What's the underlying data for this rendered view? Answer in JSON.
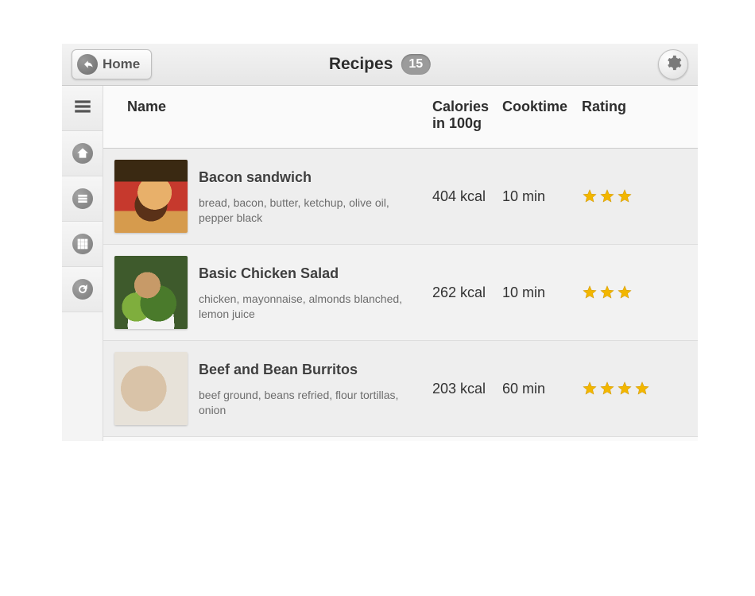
{
  "header": {
    "home_label": "Home",
    "title": "Recipes",
    "count": "15"
  },
  "columns": {
    "name": "Name",
    "calories": "Calories in 100g",
    "cooktime": "Cooktime",
    "rating": "Rating"
  },
  "recipes": [
    {
      "name": "Bacon sandwich",
      "ingredients": "bread, bacon, butter, ketchup, olive oil, pepper black",
      "calories": "404 kcal",
      "cooktime": "10 min",
      "rating": 3,
      "thumb_class": "t-burger"
    },
    {
      "name": "Basic Chicken Salad",
      "ingredients": "chicken, mayonnaise, almonds blanched, lemon juice",
      "calories": "262 kcal",
      "cooktime": "10 min",
      "rating": 3,
      "thumb_class": "t-salad"
    },
    {
      "name": "Beef and Bean Burritos",
      "ingredients": "beef ground, beans refried, flour tortillas, onion",
      "calories": "203 kcal",
      "cooktime": "60 min",
      "rating": 4,
      "thumb_class": "t-burrito"
    }
  ]
}
